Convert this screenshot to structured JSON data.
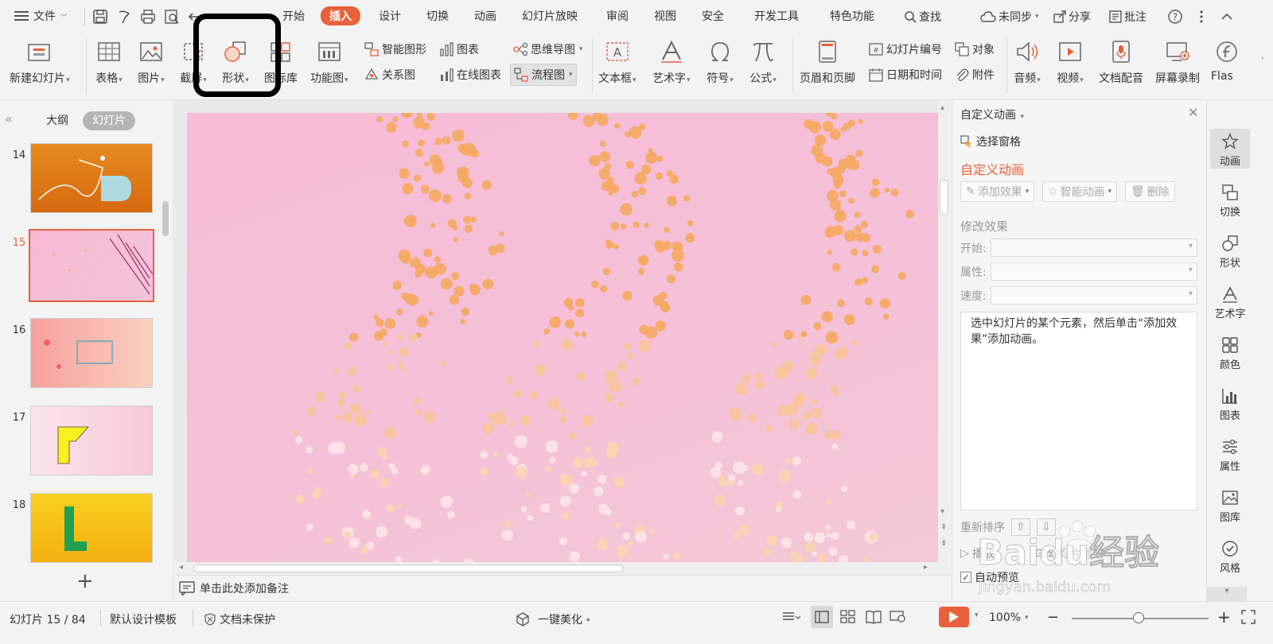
{
  "menubar": {
    "file": "文件",
    "tabs": [
      "开始",
      "插入",
      "设计",
      "切换",
      "动画",
      "幻灯片放映",
      "审阅",
      "视图",
      "安全",
      "开发工具",
      "特色功能"
    ],
    "active_tab": "插入",
    "search": "查找",
    "sync": "未同步",
    "share": "分享",
    "comment": "批注"
  },
  "ribbon": {
    "new_slide": "新建幻灯片",
    "table": "表格",
    "picture": "图片",
    "screenshot": "截屏",
    "shape": "形状",
    "icon_lib": "图标库",
    "func_chart": "功能图",
    "smart_art": "智能图形",
    "chart": "图表",
    "mind_map": "思维导图",
    "relation": "关系图",
    "online_chart": "在线图表",
    "flowchart": "流程图",
    "textbox": "文本框",
    "wordart": "艺术字",
    "symbol": "符号",
    "formula": "公式",
    "header_footer": "页眉和页脚",
    "slide_number": "幻灯片编号",
    "object": "对象",
    "datetime": "日期和时间",
    "attachment": "附件",
    "audio": "音频",
    "video": "视频",
    "narration": "文档配音",
    "screen_record": "屏幕录制",
    "flash": "Flas"
  },
  "leftpanel": {
    "tab_outline": "大纲",
    "tab_slides": "幻灯片",
    "slides": [
      {
        "num": "14"
      },
      {
        "num": "15"
      },
      {
        "num": "16"
      },
      {
        "num": "17"
      },
      {
        "num": "18"
      }
    ],
    "selected": "15"
  },
  "notes": {
    "placeholder": "单击此处添加备注"
  },
  "animpanel": {
    "title": "自定义动画",
    "select_pane": "选择窗格",
    "section": "自定义动画",
    "add_effect": "添加效果",
    "smart_anim": "智能动画",
    "delete": "删除",
    "modify": "修改效果",
    "start": "开始:",
    "property": "属性:",
    "speed": "速度:",
    "hint": "选中幻灯片的某个元素，然后单击“添加效果”添加动画。",
    "reorder": "重新排序",
    "play": "播放",
    "slideshow": "幻灯片播放",
    "autopreview": "自动预览"
  },
  "rightbar": {
    "items": [
      "动画",
      "切换",
      "形状",
      "艺术字",
      "颜色",
      "图表",
      "属性",
      "图库",
      "风格"
    ],
    "active": "动画"
  },
  "statusbar": {
    "slide_info": "幻灯片 15 / 84",
    "template": "默认设计模板",
    "protect": "文档未保护",
    "beautify": "一键美化",
    "zoom": "100%"
  },
  "watermark": {
    "text": "Baidu经验",
    "url": "jingyan.baidu.com"
  },
  "colors": {
    "accent": "#e8613a",
    "slide_bg": "#f8bcd8"
  }
}
